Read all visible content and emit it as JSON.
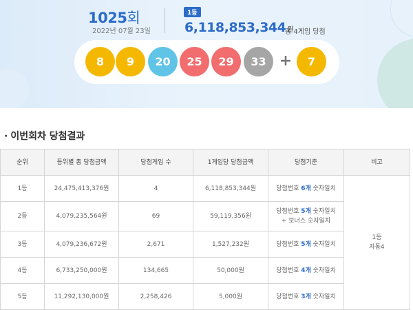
{
  "hero": {
    "round_number": "1025",
    "round_unit": "회",
    "draw_date": "2022년 07월 23일",
    "rank_badge": "1등",
    "prize_amount": "6,118,853,344",
    "prize_unit": "원",
    "prize_note": "총 4게임 당첨"
  },
  "balls": [
    {
      "number": "8",
      "color": "#f5b800"
    },
    {
      "number": "9",
      "color": "#f5b800"
    },
    {
      "number": "20",
      "color": "#60c4e6"
    },
    {
      "number": "25",
      "color": "#f26d6d"
    },
    {
      "number": "29",
      "color": "#f26d6d"
    },
    {
      "number": "33",
      "color": "#a6a6a6"
    }
  ],
  "plus": "+",
  "bonus_ball": {
    "number": "7",
    "color": "#f5b800"
  },
  "section": {
    "bullet": "·",
    "title": "이번회차 당첨결과"
  },
  "table": {
    "headers": [
      "순위",
      "등위별 총 당첨금액",
      "당첨게임 수",
      "1게임당 당첨금액",
      "당첨기준",
      "비고"
    ],
    "rows": [
      {
        "rank": "1등",
        "total": "24,475,413,376원",
        "winners": "4",
        "per_game": "6,118,853,344원",
        "crit_pre": "당첨번호 ",
        "crit_strong": "6개",
        "crit_post": " 숫자일치",
        "crit_extra": ""
      },
      {
        "rank": "2등",
        "total": "4,079,235,564원",
        "winners": "69",
        "per_game": "59,119,356원",
        "crit_pre": "당첨번호 ",
        "crit_strong": "5개",
        "crit_post": " 숫자일치",
        "crit_extra": "+ 보너스 숫자일치"
      },
      {
        "rank": "3등",
        "total": "4,079,236,672원",
        "winners": "2,671",
        "per_game": "1,527,232원",
        "crit_pre": "당첨번호 ",
        "crit_strong": "5개",
        "crit_post": " 숫자일치",
        "crit_extra": ""
      },
      {
        "rank": "4등",
        "total": "6,733,250,000원",
        "winners": "134,665",
        "per_game": "50,000원",
        "crit_pre": "당첨번호 ",
        "crit_strong": "4개",
        "crit_post": " 숫자일치",
        "crit_extra": ""
      },
      {
        "rank": "5등",
        "total": "11,292,130,000원",
        "winners": "2,258,426",
        "per_game": "5,000원",
        "crit_pre": "당첨번호 ",
        "crit_strong": "3개",
        "crit_post": " 숫자일치",
        "crit_extra": ""
      }
    ],
    "note_line1": "1등",
    "note_line2": "자동4"
  }
}
